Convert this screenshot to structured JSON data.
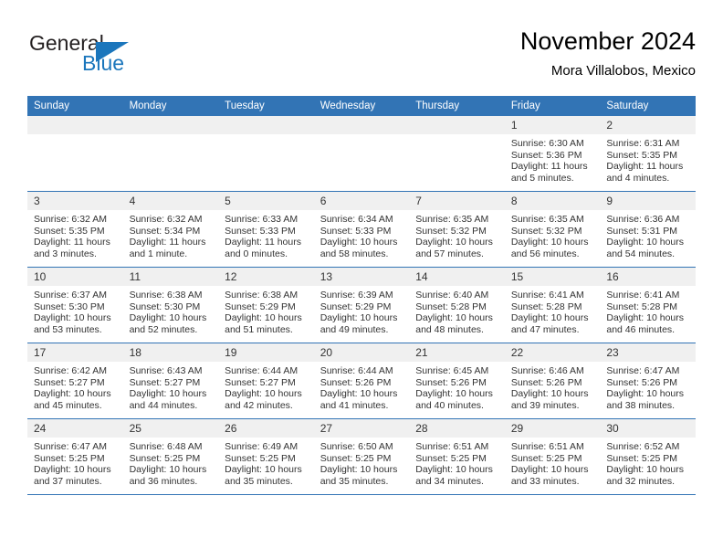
{
  "brand": {
    "name_part1": "General",
    "name_part2": "Blue",
    "accent_color": "#1b76bc"
  },
  "header": {
    "title": "November 2024",
    "subtitle": "Mora Villalobos, Mexico"
  },
  "calendar": {
    "header_bg": "#3274b5",
    "daynum_bg": "#f0f0f0",
    "weekdays": [
      "Sunday",
      "Monday",
      "Tuesday",
      "Wednesday",
      "Thursday",
      "Friday",
      "Saturday"
    ],
    "weeks": [
      [
        {
          "day": "",
          "empty": true
        },
        {
          "day": "",
          "empty": true
        },
        {
          "day": "",
          "empty": true
        },
        {
          "day": "",
          "empty": true
        },
        {
          "day": "",
          "empty": true
        },
        {
          "day": "1",
          "sunrise": "Sunrise: 6:30 AM",
          "sunset": "Sunset: 5:36 PM",
          "daylight": "Daylight: 11 hours and 5 minutes."
        },
        {
          "day": "2",
          "sunrise": "Sunrise: 6:31 AM",
          "sunset": "Sunset: 5:35 PM",
          "daylight": "Daylight: 11 hours and 4 minutes."
        }
      ],
      [
        {
          "day": "3",
          "sunrise": "Sunrise: 6:32 AM",
          "sunset": "Sunset: 5:35 PM",
          "daylight": "Daylight: 11 hours and 3 minutes."
        },
        {
          "day": "4",
          "sunrise": "Sunrise: 6:32 AM",
          "sunset": "Sunset: 5:34 PM",
          "daylight": "Daylight: 11 hours and 1 minute."
        },
        {
          "day": "5",
          "sunrise": "Sunrise: 6:33 AM",
          "sunset": "Sunset: 5:33 PM",
          "daylight": "Daylight: 11 hours and 0 minutes."
        },
        {
          "day": "6",
          "sunrise": "Sunrise: 6:34 AM",
          "sunset": "Sunset: 5:33 PM",
          "daylight": "Daylight: 10 hours and 58 minutes."
        },
        {
          "day": "7",
          "sunrise": "Sunrise: 6:35 AM",
          "sunset": "Sunset: 5:32 PM",
          "daylight": "Daylight: 10 hours and 57 minutes."
        },
        {
          "day": "8",
          "sunrise": "Sunrise: 6:35 AM",
          "sunset": "Sunset: 5:32 PM",
          "daylight": "Daylight: 10 hours and 56 minutes."
        },
        {
          "day": "9",
          "sunrise": "Sunrise: 6:36 AM",
          "sunset": "Sunset: 5:31 PM",
          "daylight": "Daylight: 10 hours and 54 minutes."
        }
      ],
      [
        {
          "day": "10",
          "sunrise": "Sunrise: 6:37 AM",
          "sunset": "Sunset: 5:30 PM",
          "daylight": "Daylight: 10 hours and 53 minutes."
        },
        {
          "day": "11",
          "sunrise": "Sunrise: 6:38 AM",
          "sunset": "Sunset: 5:30 PM",
          "daylight": "Daylight: 10 hours and 52 minutes."
        },
        {
          "day": "12",
          "sunrise": "Sunrise: 6:38 AM",
          "sunset": "Sunset: 5:29 PM",
          "daylight": "Daylight: 10 hours and 51 minutes."
        },
        {
          "day": "13",
          "sunrise": "Sunrise: 6:39 AM",
          "sunset": "Sunset: 5:29 PM",
          "daylight": "Daylight: 10 hours and 49 minutes."
        },
        {
          "day": "14",
          "sunrise": "Sunrise: 6:40 AM",
          "sunset": "Sunset: 5:28 PM",
          "daylight": "Daylight: 10 hours and 48 minutes."
        },
        {
          "day": "15",
          "sunrise": "Sunrise: 6:41 AM",
          "sunset": "Sunset: 5:28 PM",
          "daylight": "Daylight: 10 hours and 47 minutes."
        },
        {
          "day": "16",
          "sunrise": "Sunrise: 6:41 AM",
          "sunset": "Sunset: 5:28 PM",
          "daylight": "Daylight: 10 hours and 46 minutes."
        }
      ],
      [
        {
          "day": "17",
          "sunrise": "Sunrise: 6:42 AM",
          "sunset": "Sunset: 5:27 PM",
          "daylight": "Daylight: 10 hours and 45 minutes."
        },
        {
          "day": "18",
          "sunrise": "Sunrise: 6:43 AM",
          "sunset": "Sunset: 5:27 PM",
          "daylight": "Daylight: 10 hours and 44 minutes."
        },
        {
          "day": "19",
          "sunrise": "Sunrise: 6:44 AM",
          "sunset": "Sunset: 5:27 PM",
          "daylight": "Daylight: 10 hours and 42 minutes."
        },
        {
          "day": "20",
          "sunrise": "Sunrise: 6:44 AM",
          "sunset": "Sunset: 5:26 PM",
          "daylight": "Daylight: 10 hours and 41 minutes."
        },
        {
          "day": "21",
          "sunrise": "Sunrise: 6:45 AM",
          "sunset": "Sunset: 5:26 PM",
          "daylight": "Daylight: 10 hours and 40 minutes."
        },
        {
          "day": "22",
          "sunrise": "Sunrise: 6:46 AM",
          "sunset": "Sunset: 5:26 PM",
          "daylight": "Daylight: 10 hours and 39 minutes."
        },
        {
          "day": "23",
          "sunrise": "Sunrise: 6:47 AM",
          "sunset": "Sunset: 5:26 PM",
          "daylight": "Daylight: 10 hours and 38 minutes."
        }
      ],
      [
        {
          "day": "24",
          "sunrise": "Sunrise: 6:47 AM",
          "sunset": "Sunset: 5:25 PM",
          "daylight": "Daylight: 10 hours and 37 minutes."
        },
        {
          "day": "25",
          "sunrise": "Sunrise: 6:48 AM",
          "sunset": "Sunset: 5:25 PM",
          "daylight": "Daylight: 10 hours and 36 minutes."
        },
        {
          "day": "26",
          "sunrise": "Sunrise: 6:49 AM",
          "sunset": "Sunset: 5:25 PM",
          "daylight": "Daylight: 10 hours and 35 minutes."
        },
        {
          "day": "27",
          "sunrise": "Sunrise: 6:50 AM",
          "sunset": "Sunset: 5:25 PM",
          "daylight": "Daylight: 10 hours and 35 minutes."
        },
        {
          "day": "28",
          "sunrise": "Sunrise: 6:51 AM",
          "sunset": "Sunset: 5:25 PM",
          "daylight": "Daylight: 10 hours and 34 minutes."
        },
        {
          "day": "29",
          "sunrise": "Sunrise: 6:51 AM",
          "sunset": "Sunset: 5:25 PM",
          "daylight": "Daylight: 10 hours and 33 minutes."
        },
        {
          "day": "30",
          "sunrise": "Sunrise: 6:52 AM",
          "sunset": "Sunset: 5:25 PM",
          "daylight": "Daylight: 10 hours and 32 minutes."
        }
      ]
    ]
  }
}
